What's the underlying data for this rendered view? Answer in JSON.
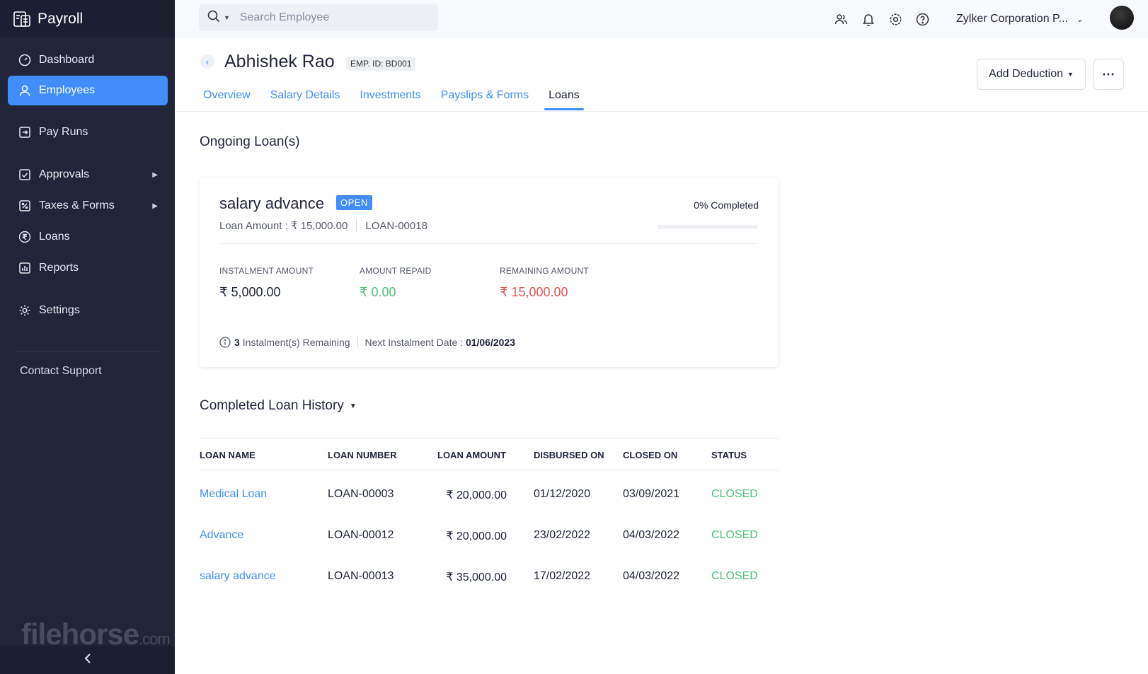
{
  "app": {
    "title": "Payroll"
  },
  "sidebar": {
    "items": [
      {
        "label": "Dashboard",
        "icon": "dashboard-icon"
      },
      {
        "label": "Employees",
        "icon": "person-icon",
        "active": true
      },
      {
        "label": "Pay Runs",
        "icon": "pay-runs-icon"
      },
      {
        "label": "Approvals",
        "icon": "approvals-icon",
        "has_submenu": true
      },
      {
        "label": "Taxes & Forms",
        "icon": "taxes-icon",
        "has_submenu": true
      },
      {
        "label": "Loans",
        "icon": "rupee-icon"
      },
      {
        "label": "Reports",
        "icon": "reports-icon"
      },
      {
        "label": "Settings",
        "icon": "gear-icon"
      }
    ],
    "contact_support": "Contact Support",
    "watermark": "filehorse",
    "watermark_suffix": ".com"
  },
  "header": {
    "search_placeholder": "Search Employee",
    "org_name": "Zylker Corporation P..."
  },
  "employee": {
    "name": "Abhishek Rao",
    "emp_id": "EMP. ID: BD001"
  },
  "actions": {
    "add_deduction": "Add Deduction"
  },
  "tabs": [
    {
      "label": "Overview"
    },
    {
      "label": "Salary Details"
    },
    {
      "label": "Investments"
    },
    {
      "label": "Payslips & Forms"
    },
    {
      "label": "Loans",
      "active": true
    }
  ],
  "ongoing": {
    "title": "Ongoing Loan(s)",
    "loan": {
      "name": "salary advance",
      "status": "OPEN",
      "completed_text": "0% Completed",
      "progress_percent": 0,
      "amount_text": "Loan Amount : ₹ 15,000.00",
      "loan_number": "LOAN-00018",
      "stats": [
        {
          "label": "INSTALMENT AMOUNT",
          "value": "₹ 5,000.00"
        },
        {
          "label": "AMOUNT REPAID",
          "value": "₹ 0.00"
        },
        {
          "label": "REMAINING AMOUNT",
          "value": "₹ 15,000.00"
        }
      ],
      "instalments_remaining": "3",
      "instalments_text": "Instalment(s) Remaining",
      "next_date_label": "Next Instalment Date :",
      "next_date": "01/06/2023"
    }
  },
  "history": {
    "title": "Completed Loan History",
    "columns": [
      "LOAN NAME",
      "LOAN NUMBER",
      "LOAN AMOUNT",
      "DISBURSED ON",
      "CLOSED ON",
      "STATUS"
    ],
    "rows": [
      {
        "name": "Medical Loan",
        "number": "LOAN-00003",
        "amount": "₹ 20,000.00",
        "disbursed": "01/12/2020",
        "closed": "03/09/2021",
        "status": "CLOSED"
      },
      {
        "name": "Advance",
        "number": "LOAN-00012",
        "amount": "₹ 20,000.00",
        "disbursed": "23/02/2022",
        "closed": "04/03/2022",
        "status": "CLOSED"
      },
      {
        "name": "salary advance",
        "number": "LOAN-00013",
        "amount": "₹ 35,000.00",
        "disbursed": "17/02/2022",
        "closed": "04/03/2022",
        "status": "CLOSED"
      }
    ]
  },
  "colors": {
    "accent": "#408dfb",
    "sidebar_bg": "#22253a",
    "success": "#4fbf7a",
    "danger": "#e05555"
  }
}
